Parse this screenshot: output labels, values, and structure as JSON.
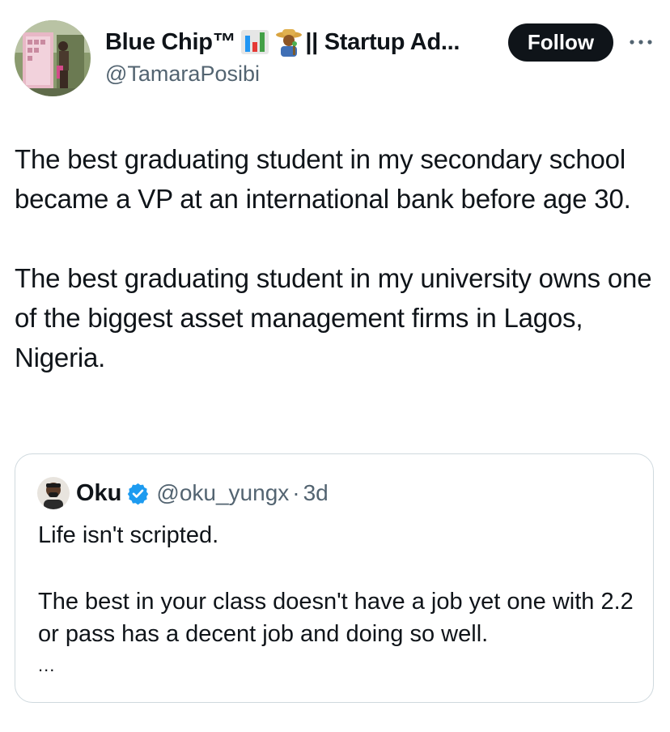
{
  "author": {
    "display_name": "Blue Chip™",
    "name_suffix": "|| Startup Ad...",
    "handle": "@TamaraPosibi",
    "emojis": [
      "bar-chart-emoji",
      "farmer-emoji"
    ]
  },
  "actions": {
    "follow_label": "Follow",
    "more_icon": "more-horizontal-icon"
  },
  "tweet": {
    "paragraph_1": "The best graduating student in my secondary school became a VP at an international bank before age 30.",
    "paragraph_2": "The best graduating student in my university owns one of the biggest asset management firms in Lagos, Nigeria."
  },
  "quote": {
    "name": "Oku",
    "verified_icon": "verified-badge-icon",
    "handle": "@oku_yungx",
    "separator": "·",
    "time": "3d",
    "paragraph_1": "Life isn't scripted.",
    "paragraph_2": "The best in your class doesn't have a job yet one with 2.2 or pass has a decent job and doing so well.",
    "ellipsis": "..."
  },
  "colors": {
    "text": "#0f1419",
    "secondary_text": "#536471",
    "follow_bg": "#0f1419",
    "verified_blue": "#1d9bf0",
    "card_border": "#cfd9de"
  }
}
